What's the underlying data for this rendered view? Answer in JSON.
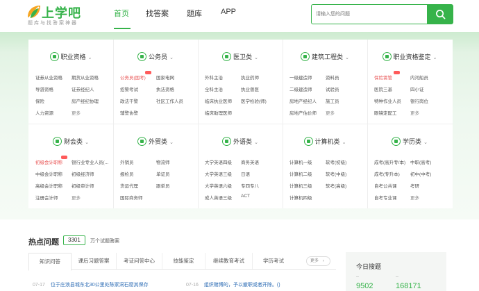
{
  "header": {
    "logo_text": "上学吧",
    "logo_slogan": "题库与找答案神器",
    "nav": [
      "首页",
      "找答案",
      "题库",
      "APP"
    ],
    "search": {
      "placeholder": "请输入您的问题"
    }
  },
  "colors": {
    "accent": "#36b34a",
    "hot": "#e85151",
    "link": "#2e6db5"
  },
  "categories": [
    {
      "title": "职业资格",
      "links": [
        "证券从业资格",
        "期货从业资格",
        "导游资格",
        "证券经纪人",
        "保险",
        "房产经纪协理",
        "人力资源",
        "更多"
      ]
    },
    {
      "title": "公务员",
      "links": [
        "公务员(国考)",
        "国家电网",
        "招警考试",
        "执法资格",
        "政法干警",
        "社区工作人员",
        "辅警协警",
        ""
      ]
    },
    {
      "title": "医卫类",
      "links": [
        "外科主治",
        "执业药师",
        "全科主治",
        "执业兽医",
        "临床执业医师",
        "医学检验(师)",
        "临床助理医师",
        ""
      ]
    },
    {
      "title": "建筑工程类",
      "links": [
        "一级建造师",
        "资料员",
        "二级建造师",
        "试验员",
        "房地产经纪人",
        "施工员",
        "房地产估价师",
        "更多"
      ]
    },
    {
      "title": "职业资格鉴定",
      "links": [
        "保险需管",
        "内河船员",
        "医院三基",
        "四小证",
        "特种作业人员",
        "银行岗位",
        "眼镜定配工",
        "更多"
      ]
    },
    {
      "title": "财会类",
      "links": [
        "初级会计职称",
        "银行业专业人员(...",
        "中级会计职称",
        "初级经济师",
        "高级会计职称",
        "初级审计师",
        "注册会计师",
        "更多"
      ]
    },
    {
      "title": "外贸类",
      "links": [
        "外销员",
        "物流师",
        "报检员",
        "单证员",
        "货运代理",
        "跟单员",
        "国际商务师",
        ""
      ]
    },
    {
      "title": "外语类",
      "links": [
        "大学英语四级",
        "商务英语",
        "大学英语三级",
        "日语",
        "大学英语六级",
        "专四专八",
        "成人英语三级",
        "ACT"
      ]
    },
    {
      "title": "计算机类",
      "links": [
        "计算机一级",
        "软考(初级)",
        "计算机二级",
        "软考(中级)",
        "计算机三级",
        "软考(高级)",
        "计算机四级",
        ""
      ]
    },
    {
      "title": "学历类",
      "links": [
        "成考(高升专/本)",
        "中职(高考)",
        "成考(专升本)",
        "初中(中考)",
        "自考公共课",
        "考研",
        "自考专业课",
        "更多"
      ]
    }
  ],
  "qa": {
    "title": "热点问题",
    "count": "3301",
    "count_label": "万个试题答案",
    "tabs": [
      "知识问答",
      "课后习题答案",
      "考证问答中心",
      "技能鉴定",
      "继续教育考试",
      "学历考试"
    ],
    "more": "更多",
    "items": [
      {
        "date": "07-17",
        "text": "位于庄浪县城东北30公里处陈家洞石窟其保存"
      },
      {
        "date": "07-16",
        "text": "组织赌博的，予以撤职或者开除。()"
      }
    ]
  },
  "today": {
    "title": "今日搜题",
    "stats": [
      {
        "label": "--",
        "value": "9502"
      },
      {
        "label": "--",
        "value": "168171"
      }
    ]
  }
}
